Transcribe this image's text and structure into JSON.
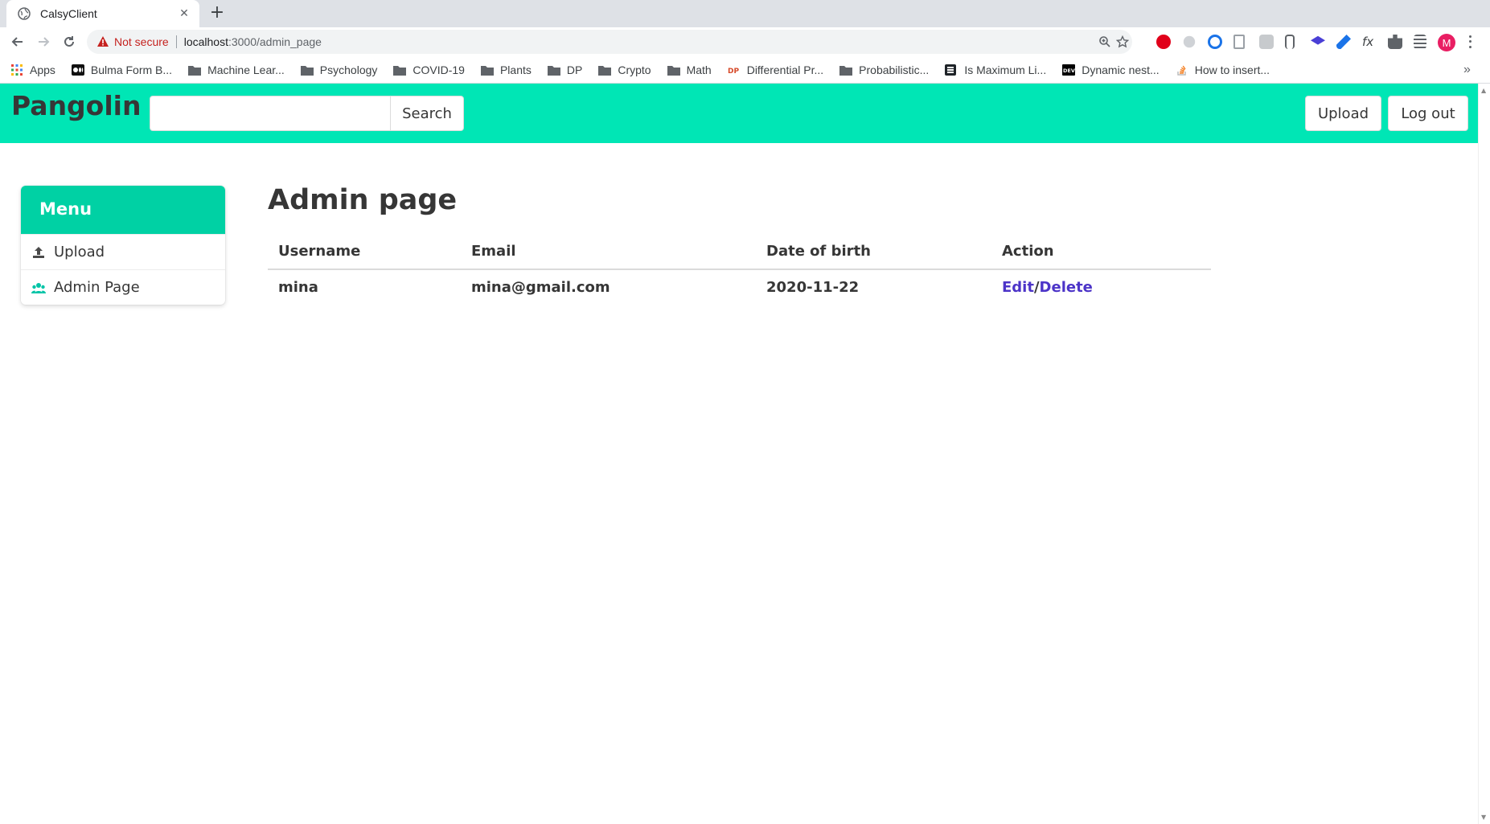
{
  "browser": {
    "tab_title": "CalsyClient",
    "new_tab": "+",
    "security_label": "Not secure",
    "url_host": "localhost",
    "url_path": ":3000/admin_page",
    "profile_initial": "M",
    "bookmarks": [
      {
        "label": "Apps",
        "icon": "apps-grid-icon"
      },
      {
        "label": "Bulma Form B...",
        "icon": "medium-icon"
      },
      {
        "label": "Machine Lear...",
        "icon": "folder-icon"
      },
      {
        "label": "Psychology",
        "icon": "folder-icon"
      },
      {
        "label": "COVID-19",
        "icon": "folder-icon"
      },
      {
        "label": "Plants",
        "icon": "folder-icon"
      },
      {
        "label": "DP",
        "icon": "folder-icon"
      },
      {
        "label": "Crypto",
        "icon": "folder-icon"
      },
      {
        "label": "Math",
        "icon": "folder-icon"
      },
      {
        "label": "Differential Pr...",
        "icon": "dp-site-icon"
      },
      {
        "label": "Probabilistic...",
        "icon": "folder-icon"
      },
      {
        "label": "Is Maximum Li...",
        "icon": "stackexchange-icon"
      },
      {
        "label": "Dynamic nest...",
        "icon": "dev-icon"
      },
      {
        "label": "How to insert...",
        "icon": "stackoverflow-icon"
      }
    ],
    "bookmarks_more": "»"
  },
  "navbar": {
    "brand": "Pangolin",
    "search_placeholder": "",
    "search_button": "Search",
    "upload_button": "Upload",
    "logout_button": "Log out"
  },
  "menu": {
    "title": "Menu",
    "items": [
      {
        "label": "Upload",
        "icon": "upload-icon"
      },
      {
        "label": "Admin Page",
        "icon": "users-icon"
      }
    ]
  },
  "main": {
    "title": "Admin page",
    "columns": [
      "Username",
      "Email",
      "Date of birth",
      "Action"
    ],
    "rows": [
      {
        "username": "mina",
        "email": "mina@gmail.com",
        "dob": "2020-11-22",
        "edit": "Edit",
        "slash": "/",
        "delete": "Delete"
      }
    ]
  },
  "colors": {
    "navbar": "#00e6b5",
    "menu_header": "#00d1a4",
    "link": "#4c34c8",
    "not_secure": "#c5221f"
  }
}
